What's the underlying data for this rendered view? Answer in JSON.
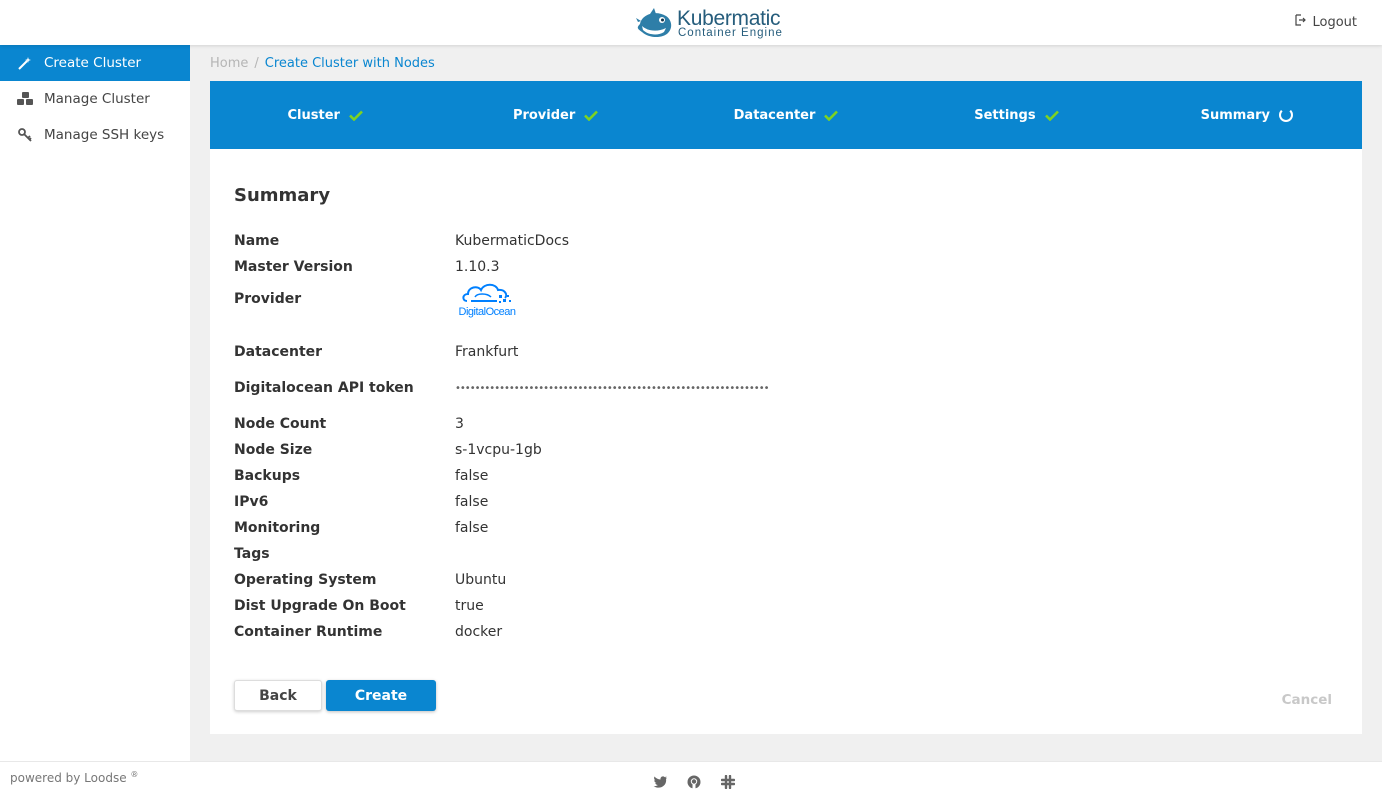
{
  "header": {
    "logo_title": "Kubermatic",
    "logo_subtitle": "Container Engine",
    "logout_label": "Logout"
  },
  "sidebar": {
    "items": [
      {
        "label": "Create Cluster",
        "icon": "magic-wand-icon",
        "active": true
      },
      {
        "label": "Manage Cluster",
        "icon": "cubes-icon",
        "active": false
      },
      {
        "label": "Manage SSH keys",
        "icon": "key-icon",
        "active": false
      }
    ]
  },
  "breadcrumb": {
    "home": "Home",
    "separator": "/",
    "current": "Create Cluster with Nodes"
  },
  "stepper": {
    "steps": [
      {
        "label": "Cluster",
        "status": "done"
      },
      {
        "label": "Provider",
        "status": "done"
      },
      {
        "label": "Datacenter",
        "status": "done"
      },
      {
        "label": "Settings",
        "status": "done"
      },
      {
        "label": "Summary",
        "status": "in-progress"
      }
    ]
  },
  "summary": {
    "title": "Summary",
    "rows": {
      "name": {
        "label": "Name",
        "value": "KubermaticDocs"
      },
      "master_version": {
        "label": "Master Version",
        "value": "1.10.3"
      },
      "provider": {
        "label": "Provider",
        "value": "DigitalOcean"
      },
      "datacenter": {
        "label": "Datacenter",
        "value": "Frankfurt"
      },
      "api_token": {
        "label": "Digitalocean API token",
        "value": "••••••••••••••••••••••••••••••••••••••••••••••••••••••••••••••••"
      },
      "node_count": {
        "label": "Node Count",
        "value": "3"
      },
      "node_size": {
        "label": "Node Size",
        "value": "s-1vcpu-1gb"
      },
      "backups": {
        "label": "Backups",
        "value": "false"
      },
      "ipv6": {
        "label": "IPv6",
        "value": "false"
      },
      "monitoring": {
        "label": "Monitoring",
        "value": "false"
      },
      "tags": {
        "label": "Tags",
        "value": ""
      },
      "os": {
        "label": "Operating System",
        "value": "Ubuntu"
      },
      "dist_upgrade": {
        "label": "Dist Upgrade On Boot",
        "value": "true"
      },
      "runtime": {
        "label": "Container Runtime",
        "value": "docker"
      }
    }
  },
  "actions": {
    "back_label": "Back",
    "create_label": "Create",
    "cancel_label": "Cancel"
  },
  "footer": {
    "powered_by": "powered by Loodse",
    "registered_mark": "®",
    "icons": [
      "twitter-icon",
      "github-icon",
      "slack-icon"
    ]
  },
  "colors": {
    "primary": "#0a86d0",
    "check": "#7ed321",
    "brand": "#265d7c"
  }
}
